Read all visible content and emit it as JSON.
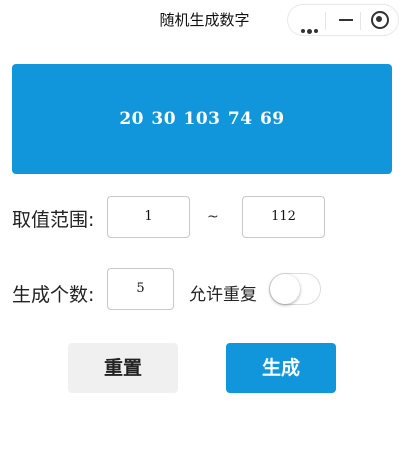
{
  "app": {
    "title": "随机生成数字"
  },
  "capsule": {
    "more_icon": "more-dots-icon",
    "minimize_icon": "minus-icon",
    "close_icon": "target-circle-icon"
  },
  "result": {
    "numbers_text": "20  30  103  74  69"
  },
  "form": {
    "range_label": "取值范围:",
    "range_min_value": "1",
    "range_separator": "~",
    "range_max_value": "112",
    "count_label": "生成个数:",
    "count_value": "5",
    "allow_repeat_label": "允许重复",
    "allow_repeat_on": false
  },
  "buttons": {
    "reset_label": "重置",
    "generate_label": "生成"
  },
  "colors": {
    "accent": "#1296db",
    "reset_bg": "#f0f0f0"
  }
}
